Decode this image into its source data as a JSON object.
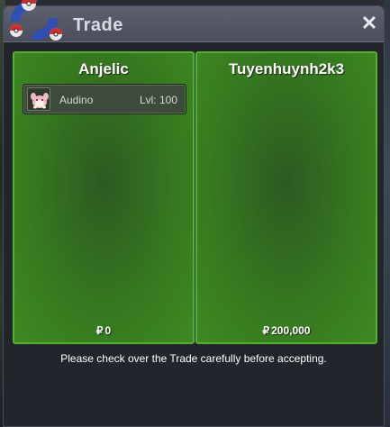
{
  "window": {
    "title": "Trade",
    "close_glyph": "✕"
  },
  "trade": {
    "left": {
      "player_name": "Anjelic",
      "items": [
        {
          "name": "Audino",
          "level_label": "Lvl: 100",
          "icon": "audino-icon"
        }
      ],
      "currency_symbol": "₽",
      "money": "0"
    },
    "right": {
      "player_name": "Tuyenhuynh2k3",
      "items": [],
      "currency_symbol": "₽",
      "money": "200,000"
    }
  },
  "footer": {
    "notice": "Please check over the Trade carefully before accepting."
  },
  "colors": {
    "panel_border": "#55b02a",
    "panel_fill": "#36771f",
    "window_bg": "#23252d",
    "titlebar": "#5d6170"
  }
}
